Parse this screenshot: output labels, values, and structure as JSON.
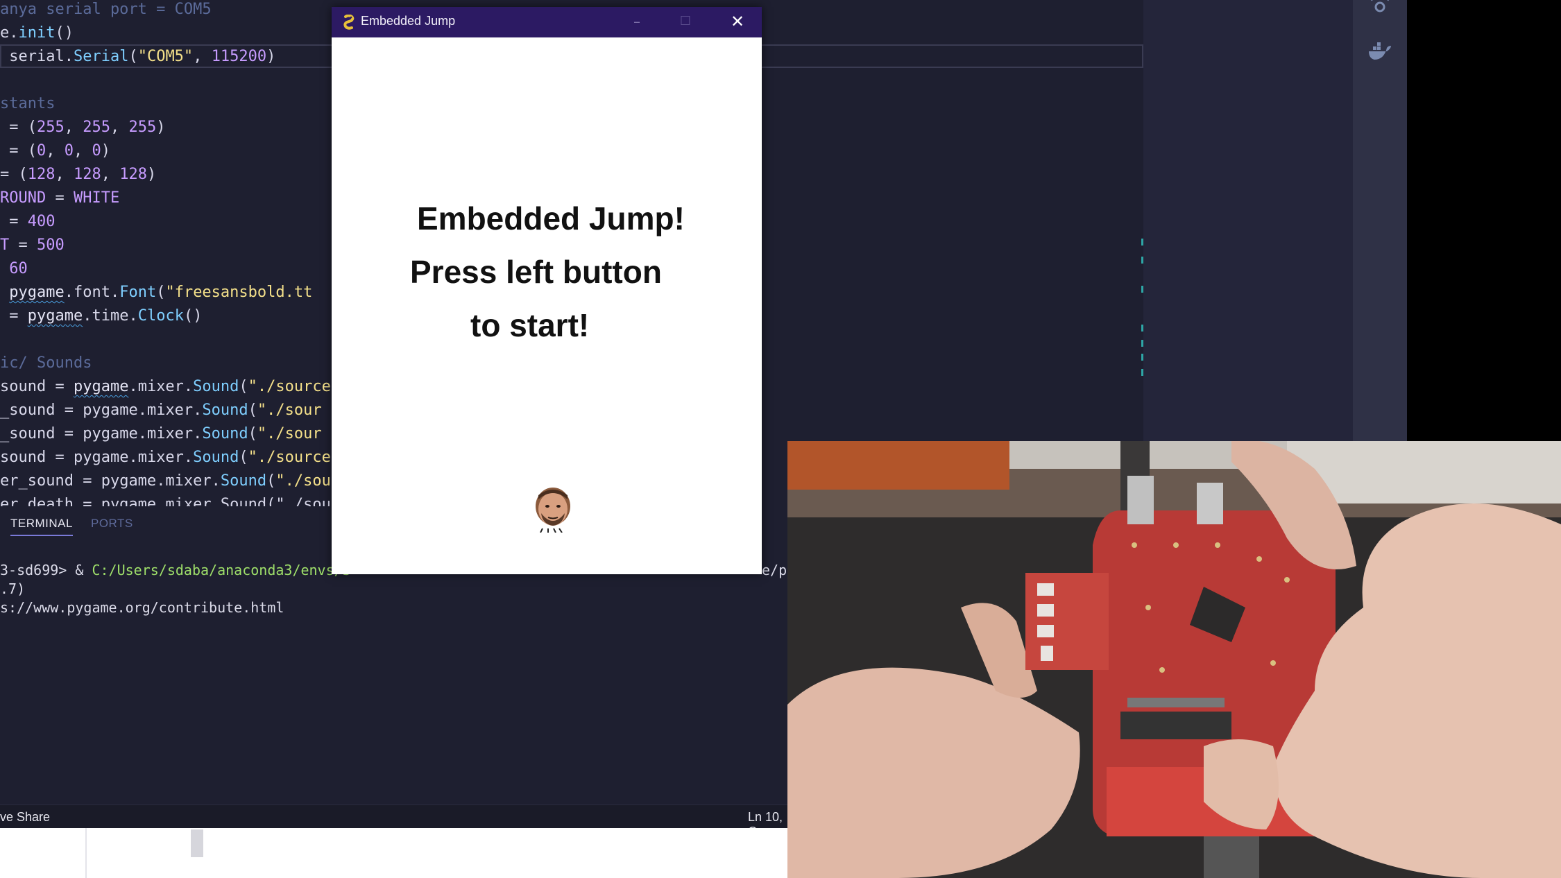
{
  "editor": {
    "lines": [
      {
        "parts": [
          {
            "t": "anya serial port = COM5",
            "c": "cmt"
          }
        ]
      },
      {
        "parts": [
          {
            "t": "e.",
            "c": ""
          },
          {
            "t": "init",
            "c": "kw-fn"
          },
          {
            "t": "()",
            "c": ""
          }
        ]
      },
      {
        "parts": [
          {
            "t": " serial.",
            "c": ""
          },
          {
            "t": "Serial",
            "c": "kw-fn"
          },
          {
            "t": "(",
            "c": ""
          },
          {
            "t": "\"COM5\"",
            "c": "str"
          },
          {
            "t": ", ",
            "c": ""
          },
          {
            "t": "115200",
            "c": "num"
          },
          {
            "t": ")",
            "c": ""
          }
        ]
      },
      {
        "parts": []
      },
      {
        "parts": [
          {
            "t": "stants",
            "c": "cmt"
          }
        ]
      },
      {
        "parts": [
          {
            "t": " = (",
            "c": ""
          },
          {
            "t": "255",
            "c": "num"
          },
          {
            "t": ", ",
            "c": ""
          },
          {
            "t": "255",
            "c": "num"
          },
          {
            "t": ", ",
            "c": ""
          },
          {
            "t": "255",
            "c": "num"
          },
          {
            "t": ")",
            "c": ""
          }
        ]
      },
      {
        "parts": [
          {
            "t": " = (",
            "c": ""
          },
          {
            "t": "0",
            "c": "num"
          },
          {
            "t": ", ",
            "c": ""
          },
          {
            "t": "0",
            "c": "num"
          },
          {
            "t": ", ",
            "c": ""
          },
          {
            "t": "0",
            "c": "num"
          },
          {
            "t": ")",
            "c": ""
          }
        ]
      },
      {
        "parts": [
          {
            "t": "= (",
            "c": ""
          },
          {
            "t": "128",
            "c": "num"
          },
          {
            "t": ", ",
            "c": ""
          },
          {
            "t": "128",
            "c": "num"
          },
          {
            "t": ", ",
            "c": ""
          },
          {
            "t": "128",
            "c": "num"
          },
          {
            "t": ")",
            "c": ""
          }
        ]
      },
      {
        "parts": [
          {
            "t": "ROUND",
            "c": "const"
          },
          {
            "t": " = ",
            "c": ""
          },
          {
            "t": "WHITE",
            "c": "const"
          }
        ]
      },
      {
        "parts": [
          {
            "t": " = ",
            "c": ""
          },
          {
            "t": "400",
            "c": "num"
          }
        ]
      },
      {
        "parts": [
          {
            "t": "T",
            "c": "const"
          },
          {
            "t": " = ",
            "c": ""
          },
          {
            "t": "500",
            "c": "num"
          }
        ]
      },
      {
        "parts": [
          {
            "t": " ",
            "c": ""
          },
          {
            "t": "60",
            "c": "num"
          }
        ]
      },
      {
        "parts": [
          {
            "t": " ",
            "c": ""
          },
          {
            "t": "pygame",
            "c": "kw-mod"
          },
          {
            "t": ".font.",
            "c": ""
          },
          {
            "t": "Font",
            "c": "kw-fn"
          },
          {
            "t": "(",
            "c": ""
          },
          {
            "t": "\"freesansbold.tt",
            "c": "str"
          }
        ]
      },
      {
        "parts": [
          {
            "t": " = ",
            "c": ""
          },
          {
            "t": "pygame",
            "c": "kw-mod"
          },
          {
            "t": ".time.",
            "c": ""
          },
          {
            "t": "Clock",
            "c": "kw-fn"
          },
          {
            "t": "()",
            "c": ""
          }
        ]
      },
      {
        "parts": []
      },
      {
        "parts": [
          {
            "t": "ic/ Sounds",
            "c": "cmt"
          }
        ]
      },
      {
        "parts": [
          {
            "t": "sound = ",
            "c": ""
          },
          {
            "t": "pygame",
            "c": "kw-mod"
          },
          {
            "t": ".mixer.",
            "c": ""
          },
          {
            "t": "Sound",
            "c": "kw-fn"
          },
          {
            "t": "(",
            "c": ""
          },
          {
            "t": "\"./source",
            "c": "str"
          }
        ]
      },
      {
        "parts": [
          {
            "t": "_sound = ",
            "c": ""
          },
          {
            "t": "pygame",
            "c": ""
          },
          {
            "t": ".mixer.",
            "c": ""
          },
          {
            "t": "Sound",
            "c": "kw-fn"
          },
          {
            "t": "(",
            "c": ""
          },
          {
            "t": "\"./sour",
            "c": "str"
          }
        ]
      },
      {
        "parts": [
          {
            "t": "_sound = ",
            "c": ""
          },
          {
            "t": "pygame",
            "c": ""
          },
          {
            "t": ".mixer.",
            "c": ""
          },
          {
            "t": "Sound",
            "c": "kw-fn"
          },
          {
            "t": "(",
            "c": ""
          },
          {
            "t": "\"./sour",
            "c": "str"
          }
        ]
      },
      {
        "parts": [
          {
            "t": "sound = ",
            "c": ""
          },
          {
            "t": "pygame",
            "c": ""
          },
          {
            "t": ".mixer.",
            "c": ""
          },
          {
            "t": "Sound",
            "c": "kw-fn"
          },
          {
            "t": "(",
            "c": ""
          },
          {
            "t": "\"./source",
            "c": "str"
          }
        ]
      },
      {
        "parts": [
          {
            "t": "er_sound = ",
            "c": ""
          },
          {
            "t": "pygame",
            "c": ""
          },
          {
            "t": ".mixer.",
            "c": ""
          },
          {
            "t": "Sound",
            "c": "kw-fn"
          },
          {
            "t": "(",
            "c": ""
          },
          {
            "t": "\"./sou",
            "c": "str"
          }
        ]
      },
      {
        "parts": [
          {
            "t": "er_death = pygame.mixer.Sound(\"./sou",
            "c": ""
          }
        ]
      }
    ]
  },
  "terminal": {
    "tabs": [
      "TERMINAL",
      "PORTS"
    ],
    "line1_prefix": "3-sd699> & ",
    "line1_path": "C:/Users/sdaba/anaconda3/envs/3",
    "line1_tail": "e/p",
    "line2": ".7)",
    "line3": "s://www.pygame.org/contribute.html"
  },
  "statusbar": {
    "left": "ve Share",
    "right": "Ln 10, C"
  },
  "game_window": {
    "title": "Embedded Jump",
    "minimize": "–",
    "maximize": "☐",
    "close": "✕",
    "line1": "Embedded Jump!",
    "line2": "Press left button",
    "line3": "to start!"
  },
  "icons": {
    "activity_top": "remote-explorer-icon",
    "activity_docker": "docker-icon",
    "game_logo": "pygame-snake-icon",
    "player": "player-head-sprite"
  }
}
